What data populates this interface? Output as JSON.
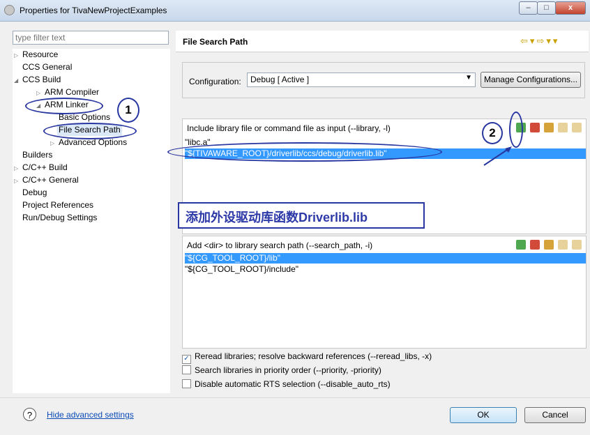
{
  "window": {
    "title": "Properties for TivaNewProjectExamples",
    "buttons": [
      "–",
      "□",
      "x"
    ]
  },
  "left": {
    "filter_placeholder": "type filter text",
    "tree": [
      {
        "label": "Resource",
        "arrow": "▷"
      },
      {
        "label": "CCS General",
        "arrow": ""
      },
      {
        "label": "CCS Build",
        "arrow": "◢"
      },
      {
        "label": "ARM Compiler",
        "arrow": "▷"
      },
      {
        "label": "ARM Linker",
        "arrow": "◢"
      },
      {
        "label": "Basic Options",
        "arrow": ""
      },
      {
        "label": "File Search Path",
        "arrow": ""
      },
      {
        "label": "Advanced Options",
        "arrow": "▷"
      },
      {
        "label": "Builders",
        "arrow": ""
      },
      {
        "label": "C/C++ Build",
        "arrow": "▷"
      },
      {
        "label": "C/C++ General",
        "arrow": "▷"
      },
      {
        "label": "Debug",
        "arrow": ""
      },
      {
        "label": "Project References",
        "arrow": ""
      },
      {
        "label": "Run/Debug Settings",
        "arrow": ""
      }
    ]
  },
  "right": {
    "title": "File Search Path",
    "nav": [
      "⇦",
      "▾",
      "⇨",
      "▾",
      "▾"
    ],
    "config_label": "Configuration:",
    "config_value": "Debug  [ Active ]",
    "manage_label": "Manage Configurations...",
    "lib_title": "Include library file or command file as input (--library, -l)",
    "lib_items": [
      "\"libc.a\"",
      "\"${TIVAWARE_ROOT}/driverlib/ccs/debug/driverlib.lib\""
    ],
    "path_title": "Add <dir> to library search path (--search_path, -i)",
    "path_items": [
      "\"${CG_TOOL_ROOT}/lib\"",
      "\"${CG_TOOL_ROOT}/include\""
    ],
    "checkboxes": [
      {
        "label": "Reread libraries; resolve backward references (--reread_libs, -x)",
        "mark": "✓"
      },
      {
        "label": "Search libraries in priority order (--priority, -priority)",
        "mark": ""
      },
      {
        "label": "Disable automatic RTS selection (--disable_auto_rts)",
        "mark": ""
      }
    ]
  },
  "footer": {
    "help_icon": "?",
    "help_link": "Hide advanced settings",
    "ok": "OK",
    "cancel": "Cancel"
  },
  "annotations": {
    "caption": "添加外设驱动库函数Driverlib.lib",
    "num1": "1",
    "num2": "2",
    "color": "#2836a0"
  }
}
